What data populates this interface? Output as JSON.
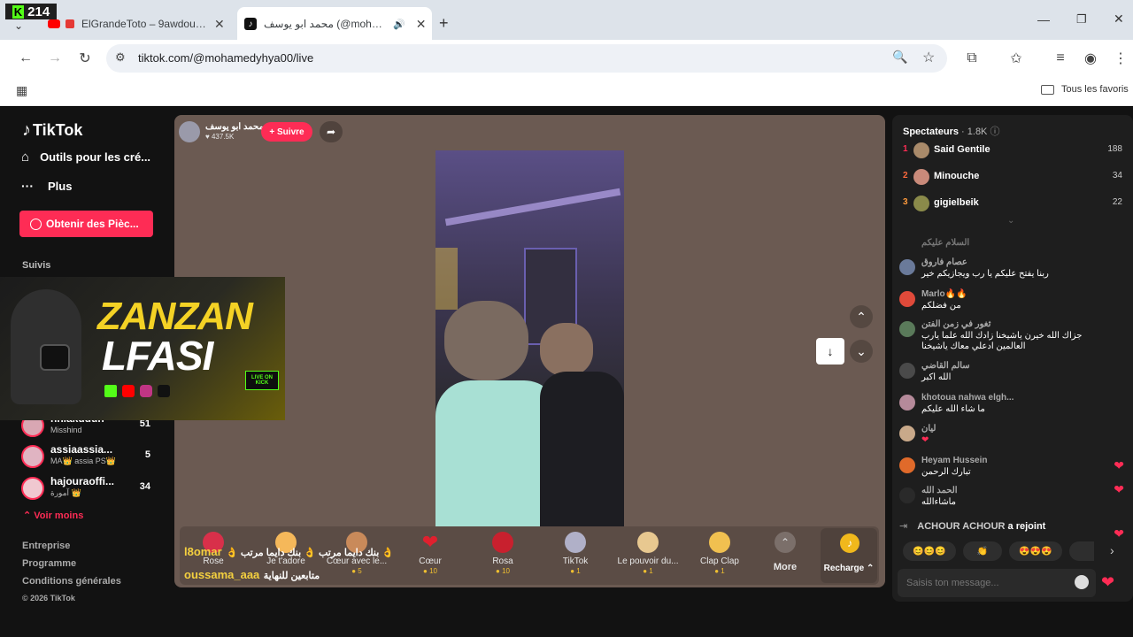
{
  "overlay_badge": "214",
  "tabs": [
    {
      "title": "ElGrandeToto – 9awdouha (",
      "icon": "youtube-icon"
    },
    {
      "title": "محمد ابو يوسف (@mohamedyhya00",
      "icon": "tiktok-icon"
    }
  ],
  "address": "tiktok.com/@mohamedyhya00/live",
  "bookmarks_label": "Tous les favoris",
  "sidebar": {
    "brand": "TikTok",
    "nav": [
      "Outils pour les cré...",
      "Plus"
    ],
    "coins_button": "Obtenir des Pièc...",
    "following_heading": "Suivis",
    "following": [
      {
        "name": "nhiakudun",
        "sub": "Misshind",
        "count": "51"
      },
      {
        "name": "assiaassia...",
        "sub": "MA👑 assia PS👑",
        "count": "5"
      },
      {
        "name": "hajouraoffi...",
        "sub": "آمورة 👑",
        "count": "34"
      }
    ],
    "see_more": "Voir moins",
    "footer": [
      "Entreprise",
      "Programme",
      "Conditions générales",
      "© 2026 TikTok"
    ]
  },
  "banner": {
    "line1": "ZANZAN",
    "line2": "LFASI",
    "badge": "LIVE ON KICK"
  },
  "player": {
    "host_name": "محمد ابو يوسف",
    "host_likes": "437.5K",
    "follow_label": "+ Suivre",
    "overlay_comments": [
      {
        "user": "l8omar",
        "text": "👌 بنك دايما مرتب 👌 بنك دايما مرتب 👌"
      },
      {
        "user": "oussama_aaa",
        "text": "متابعين للنهاية"
      }
    ],
    "gifts": [
      {
        "name": "Rose",
        "price": "1"
      },
      {
        "name": "Je t'adore",
        "price": "1"
      },
      {
        "name": "Cœur avec le...",
        "price": "5"
      },
      {
        "name": "Cœur",
        "price": "10"
      },
      {
        "name": "Rosa",
        "price": "10"
      },
      {
        "name": "TikTok",
        "price": "1"
      },
      {
        "name": "Le pouvoir du...",
        "price": "1"
      },
      {
        "name": "Clap Clap",
        "price": "1"
      }
    ],
    "more_label": "More",
    "recharge_label": "Recharge"
  },
  "chat": {
    "viewers_label": "Spectateurs",
    "viewers_count": "· 1.8K",
    "top_viewers": [
      {
        "rank": "1",
        "name": "Said Gentile",
        "count": "188"
      },
      {
        "rank": "2",
        "name": "Minouche",
        "count": "34"
      },
      {
        "rank": "3",
        "name": "gigielbeik",
        "count": "22"
      }
    ],
    "messages": [
      {
        "name": "السلام عليكم",
        "text": ""
      },
      {
        "name": "عصام فاروق",
        "text": "ربنا يفتح عليكم يا رب ويجازيكم خير"
      },
      {
        "name": "Marlo🔥🔥",
        "text": "من فضلكم"
      },
      {
        "name": "ثغور في زمن الفتن",
        "text": "جزاك الله خيرن ياشيخنا زادك الله علما يارب العالمين ادعلي معاك ياشيخنا"
      },
      {
        "name": "سالم القاضي",
        "text": "الله اكبر"
      },
      {
        "name": "khotoua nahwa elgh...",
        "text": "ما شاء الله عليكم"
      },
      {
        "name": "ليان",
        "text": "❤"
      },
      {
        "name": "Heyam Hussein",
        "text": "تبارك الرحمن"
      },
      {
        "name": "الحمد الله",
        "text": "ماشاءالله"
      }
    ],
    "join_user": "ACHOUR ACHOUR",
    "join_text": "a rejoint",
    "quick_reactions": [
      "😊😊😊",
      "👏",
      "😍😍😍"
    ],
    "input_placeholder": "Saisis ton message..."
  }
}
